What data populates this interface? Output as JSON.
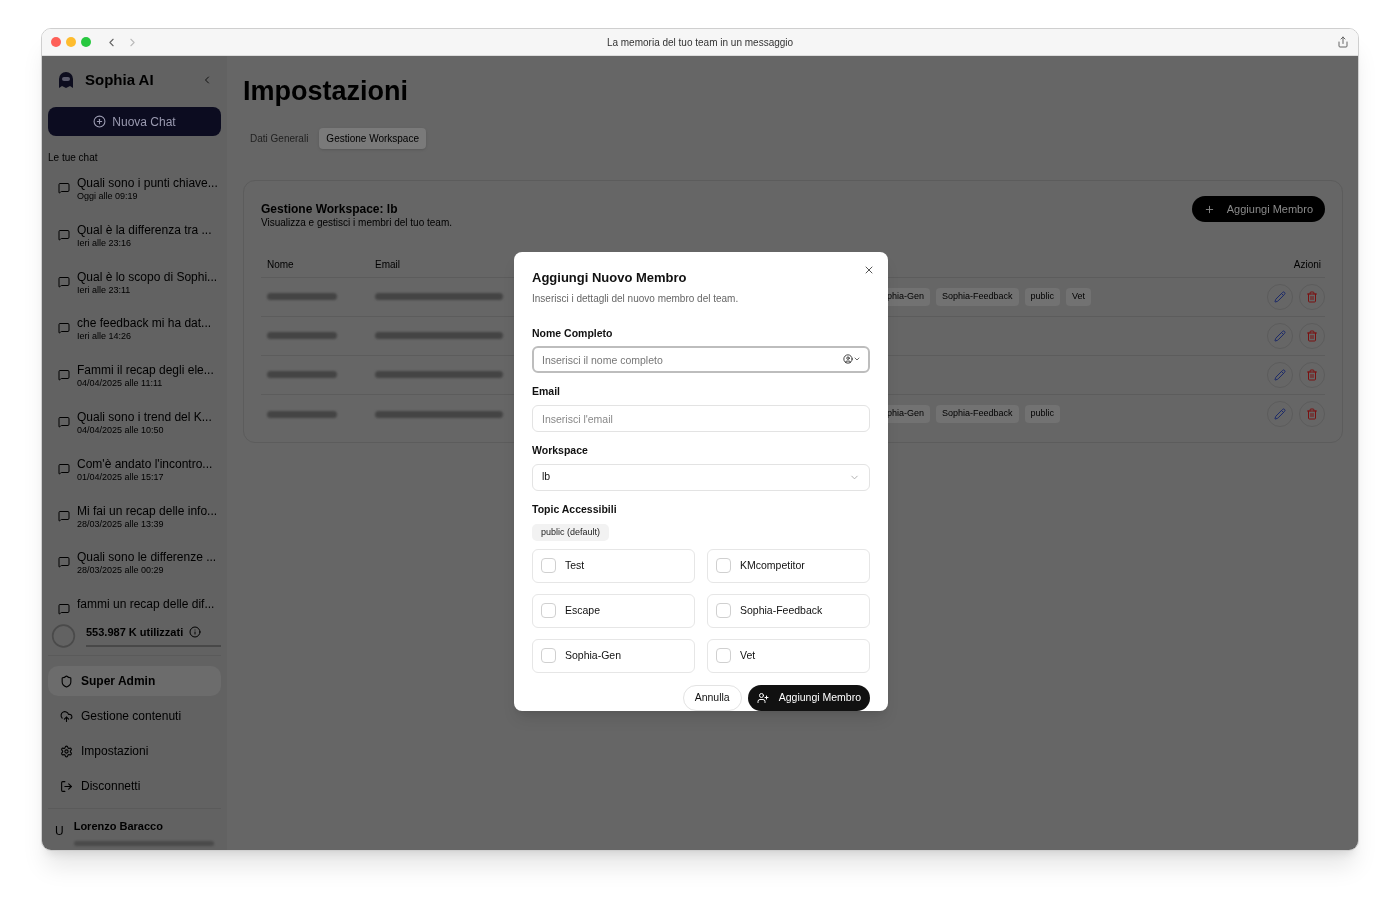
{
  "window": {
    "title": "La memoria del tuo team in un messaggio"
  },
  "sidebar": {
    "brand": "Sophia AI",
    "new_chat": "Nuova Chat",
    "section": "Le tue chat",
    "chats": [
      {
        "title": "Quali sono i punti chiave...",
        "time": "Oggi alle 09:19"
      },
      {
        "title": "Qual è la differenza tra ...",
        "time": "Ieri alle 23:16"
      },
      {
        "title": "Qual è lo scopo di Sophi...",
        "time": "Ieri alle 23:11"
      },
      {
        "title": "che feedback mi ha dat...",
        "time": "Ieri alle 14:26"
      },
      {
        "title": "Fammi il recap degli ele...",
        "time": "04/04/2025 alle 11:11"
      },
      {
        "title": "Quali sono i trend del K...",
        "time": "04/04/2025 alle 10:50"
      },
      {
        "title": "Com'è andato l'incontro...",
        "time": "01/04/2025 alle 15:17"
      },
      {
        "title": "Mi fai un recap delle info...",
        "time": "28/03/2025 alle 13:39"
      },
      {
        "title": "Quali sono le differenze ...",
        "time": "28/03/2025 alle 00:29"
      },
      {
        "title": "fammi un recap delle dif..."
      }
    ],
    "usage": "553.987 K utilizzati",
    "nav": [
      {
        "kind": "shield",
        "label": "Super Admin",
        "selected": true
      },
      {
        "kind": "upload",
        "label": "Gestione contenuti",
        "selected": false
      },
      {
        "kind": "settings",
        "label": "Impostazioni",
        "selected": false
      },
      {
        "kind": "logout",
        "label": "Disconnetti",
        "selected": false
      }
    ],
    "user": {
      "initial": "U",
      "name": "Lorenzo Baracco"
    }
  },
  "main": {
    "title": "Impostazioni",
    "tabs": [
      {
        "label": "Dati Generali",
        "selected": false
      },
      {
        "label": "Gestione Workspace",
        "selected": true
      }
    ],
    "card": {
      "title": "Gestione Workspace: lb",
      "subtitle": "Visualizza e gestisci i membri del tuo team.",
      "add_button": "Aggiungi Membro",
      "columns": [
        "Nome",
        "Email",
        "Azioni"
      ],
      "rows": [
        {
          "tags": [
            "phia-Gen",
            "Sophia-Feedback",
            "public",
            "Vet"
          ]
        },
        {
          "tags": []
        },
        {
          "tags": []
        },
        {
          "tags": [
            "phia-Gen",
            "Sophia-Feedback",
            "public"
          ]
        }
      ]
    }
  },
  "modal": {
    "title": "Aggiungi Nuovo Membro",
    "description": "Inserisci i dettagli del nuovo membro del team.",
    "name_field": {
      "label": "Nome Completo",
      "placeholder": "Inserisci il nome completo"
    },
    "email_field": {
      "label": "Email",
      "placeholder": "Inserisci l'email"
    },
    "workspace_field": {
      "label": "Workspace",
      "value": "lb"
    },
    "topics": {
      "label": "Topic Accessibili",
      "default_chip": "public (default)",
      "options": [
        {
          "label": "Test",
          "checked": false
        },
        {
          "label": "KMcompetitor",
          "checked": false
        },
        {
          "label": "Escape",
          "checked": false
        },
        {
          "label": "Sophia-Feedback",
          "checked": false
        },
        {
          "label": "Sophia-Gen",
          "checked": false
        },
        {
          "label": "Vet",
          "checked": false
        }
      ]
    },
    "cancel": "Annulla",
    "submit": "Aggiungi Membro"
  }
}
